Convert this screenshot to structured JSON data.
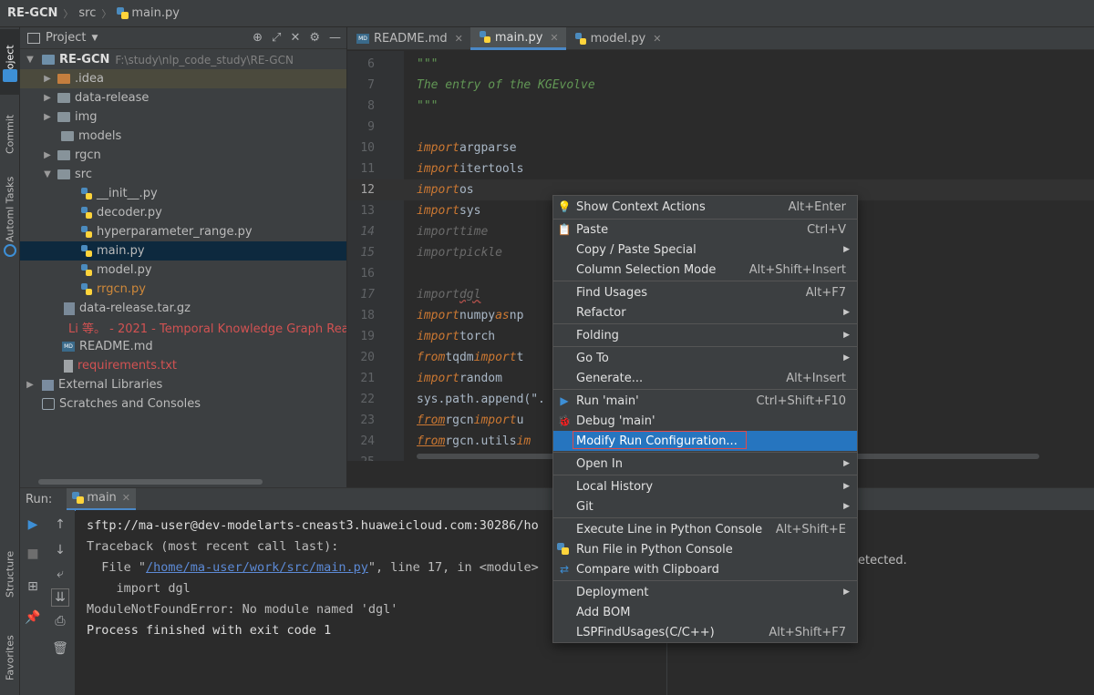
{
  "breadcrumb": {
    "project": "RE-GCN",
    "folder": "src",
    "file": "main.py"
  },
  "side_tabs": {
    "project": "Project",
    "commit": "Commit",
    "automl": "Automl Tasks",
    "structure": "Structure",
    "favorites": "Favorites"
  },
  "project_panel": {
    "title": "Project",
    "root_name": "RE-GCN",
    "root_path": "F:\\study\\nlp_code_study\\RE-GCN",
    "items": [
      {
        "label": ".idea",
        "kind": "folder-orange"
      },
      {
        "label": "data-release",
        "kind": "folder"
      },
      {
        "label": "img",
        "kind": "folder"
      },
      {
        "label": "models",
        "kind": "folder"
      },
      {
        "label": "rgcn",
        "kind": "folder"
      },
      {
        "label": "src",
        "kind": "folder"
      },
      {
        "label": "__init__.py",
        "kind": "py"
      },
      {
        "label": "decoder.py",
        "kind": "py"
      },
      {
        "label": "hyperparameter_range.py",
        "kind": "py"
      },
      {
        "label": "main.py",
        "kind": "py"
      },
      {
        "label": "model.py",
        "kind": "py"
      },
      {
        "label": "rrgcn.py",
        "kind": "py"
      },
      {
        "label": "data-release.tar.gz",
        "kind": "gz"
      },
      {
        "label": "Li 等。 - 2021 - Temporal Knowledge Graph Reas",
        "kind": "pdf"
      },
      {
        "label": "README.md",
        "kind": "md"
      },
      {
        "label": "requirements.txt",
        "kind": "txt"
      },
      {
        "label": "External Libraries",
        "kind": "lib"
      },
      {
        "label": "Scratches and Consoles",
        "kind": "scratch"
      }
    ]
  },
  "editor_tabs": [
    {
      "label": "README.md"
    },
    {
      "label": "main.py"
    },
    {
      "label": "model.py"
    }
  ],
  "code_lines": [
    {
      "num": "6",
      "text": "\"\"\""
    },
    {
      "num": "7",
      "text": "The entry of the KGEvolve"
    },
    {
      "num": "8",
      "text": "\"\"\""
    },
    {
      "num": "9",
      "text": ""
    },
    {
      "num": "10",
      "kw": "import",
      "rest": " argparse"
    },
    {
      "num": "11",
      "kw": "import",
      "rest": " itertools"
    },
    {
      "num": "12",
      "kw": "import",
      "rest": " os"
    },
    {
      "num": "13",
      "kw": "import",
      "rest": " sys"
    },
    {
      "num": "14",
      "kw": "import",
      "rest": " time"
    },
    {
      "num": "15",
      "kw": "import",
      "rest": " pickle"
    },
    {
      "num": "16",
      "text": ""
    },
    {
      "num": "17",
      "kw": "import",
      "rest": " dgl"
    },
    {
      "num": "18",
      "kw": "import",
      "rest": " numpy ",
      "kw2": "as",
      "rest2": " np"
    },
    {
      "num": "19",
      "kw": "import",
      "rest": " torch"
    },
    {
      "num": "20",
      "kw": "from",
      "rest": " tqdm ",
      "kw2": "import",
      "rest2": " t"
    },
    {
      "num": "21",
      "kw": "import",
      "rest": " random"
    },
    {
      "num": "22",
      "text": "sys.path.append(\"."
    },
    {
      "num": "23",
      "kw": "from",
      "rest": " rgcn ",
      "kw2": "import",
      "rest2": " u"
    },
    {
      "num": "24",
      "kw": "from",
      "rest": " rgcn.utils ",
      "kw2": "im",
      "rest2": ""
    },
    {
      "num": "25",
      "text": ""
    }
  ],
  "run_panel": {
    "label": "Run:",
    "tab": "main"
  },
  "console": {
    "line1": "sftp://ma-user@dev-modelarts-cneast3.huaweicloud.com:30286/ho",
    "line2": "Traceback (most recent call last):",
    "line3_prefix": "  File \"",
    "line3_link": "/home/ma-user/work/src/main.py",
    "line3_suffix": "\", line 17, in <module>",
    "line4": "    import dgl",
    "line5": "ModuleNotFoundError: No module named 'dgl'",
    "line6": "",
    "line7": "Process finished with exit code 1",
    "right_text": "etected."
  },
  "context_menu": [
    {
      "label": "Show Context Actions",
      "shortcut": "Alt+Enter",
      "icon": "bulb-icon"
    },
    {
      "label": "Paste",
      "shortcut": "Ctrl+V",
      "icon": "paste-icon"
    },
    {
      "label": "Copy / Paste Special",
      "submenu": true
    },
    {
      "label": "Column Selection Mode",
      "shortcut": "Alt+Shift+Insert"
    },
    {
      "label": "Find Usages",
      "shortcut": "Alt+F7"
    },
    {
      "label": "Refactor",
      "submenu": true
    },
    {
      "label": "Folding",
      "submenu": true
    },
    {
      "label": "Go To",
      "submenu": true
    },
    {
      "label": "Generate...",
      "shortcut": "Alt+Insert"
    },
    {
      "label": "Run 'main'",
      "shortcut": "Ctrl+Shift+F10",
      "icon": "run-icon"
    },
    {
      "label": "Debug 'main'",
      "icon": "debug-icon"
    },
    {
      "label": "Modify Run Configuration...",
      "highlighted": true
    },
    {
      "label": "Open In",
      "submenu": true
    },
    {
      "label": "Local History",
      "submenu": true
    },
    {
      "label": "Git",
      "submenu": true
    },
    {
      "label": "Execute Line in Python Console",
      "shortcut": "Alt+Shift+E"
    },
    {
      "label": "Run File in Python Console",
      "icon": "python-icon"
    },
    {
      "label": "Compare with Clipboard",
      "icon": "compare-icon"
    },
    {
      "label": "Deployment",
      "submenu": true
    },
    {
      "label": "Add BOM"
    },
    {
      "label": "LSPFindUsages(C/C++)",
      "shortcut": "Alt+Shift+F7"
    }
  ],
  "colors": {
    "accent": "#2675bf",
    "keyword": "#cc7832",
    "docstring": "#629755",
    "error_link": "#5c8ad6",
    "highlight_box": "#e04a4a"
  }
}
